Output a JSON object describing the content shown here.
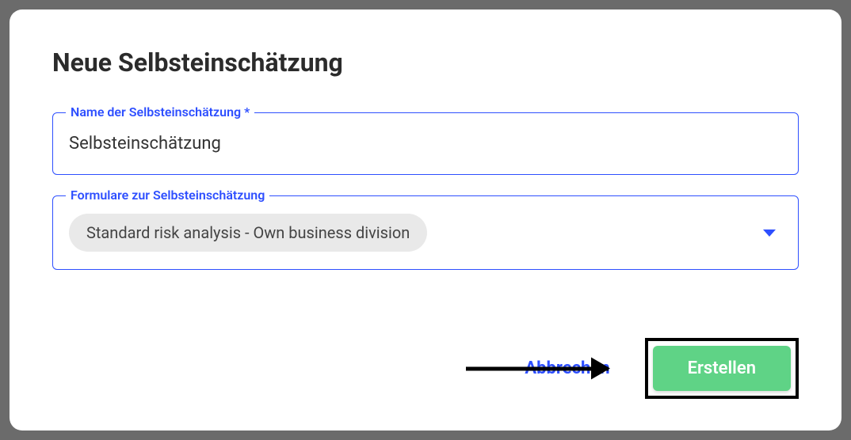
{
  "dialog": {
    "title": "Neue Selbsteinschätzung",
    "name_field": {
      "label": "Name der Selbsteinschätzung *",
      "value": "Selbsteinschätzung"
    },
    "forms_field": {
      "label": "Formulare zur Selbsteinschätzung",
      "selected": "Standard risk analysis - Own business division"
    },
    "actions": {
      "cancel": "Abbrechen",
      "create": "Erstellen"
    }
  }
}
